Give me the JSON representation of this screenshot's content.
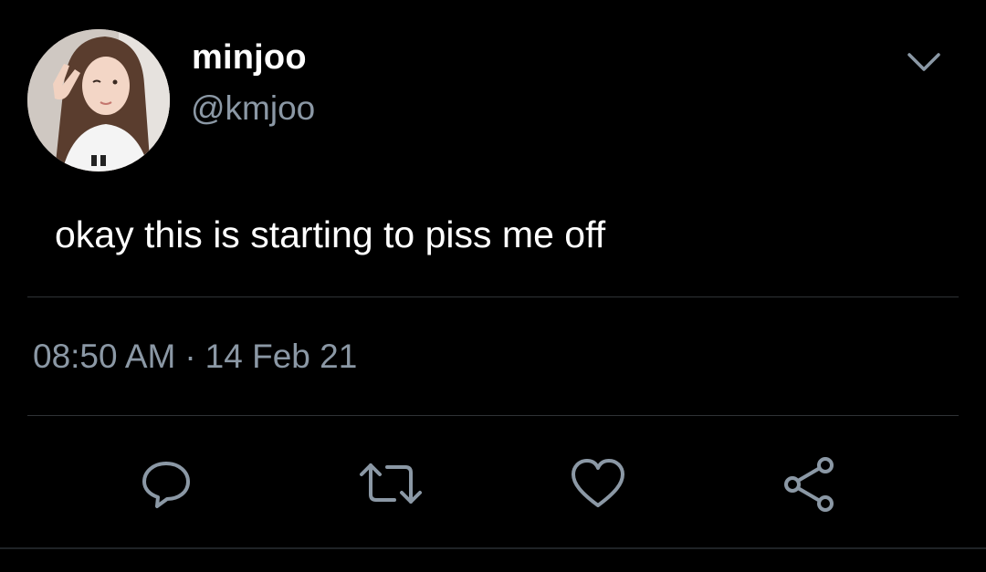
{
  "user": {
    "display_name": "minjoo",
    "handle": "@kmjoo",
    "avatar_icon": "profile-photo"
  },
  "tweet": {
    "text": "okay this is starting to piss me off",
    "time": "08:50 AM",
    "separator": "·",
    "date": "14 Feb 21"
  },
  "actions": [
    {
      "name": "reply",
      "icon": "speech-bubble-icon"
    },
    {
      "name": "retweet",
      "icon": "retweet-arrows-icon"
    },
    {
      "name": "like",
      "icon": "heart-icon"
    },
    {
      "name": "share",
      "icon": "share-icon"
    }
  ],
  "colors": {
    "background": "#000000",
    "primary_text": "#ffffff",
    "secondary_text": "#8b98a5",
    "divider": "#2f3336"
  }
}
